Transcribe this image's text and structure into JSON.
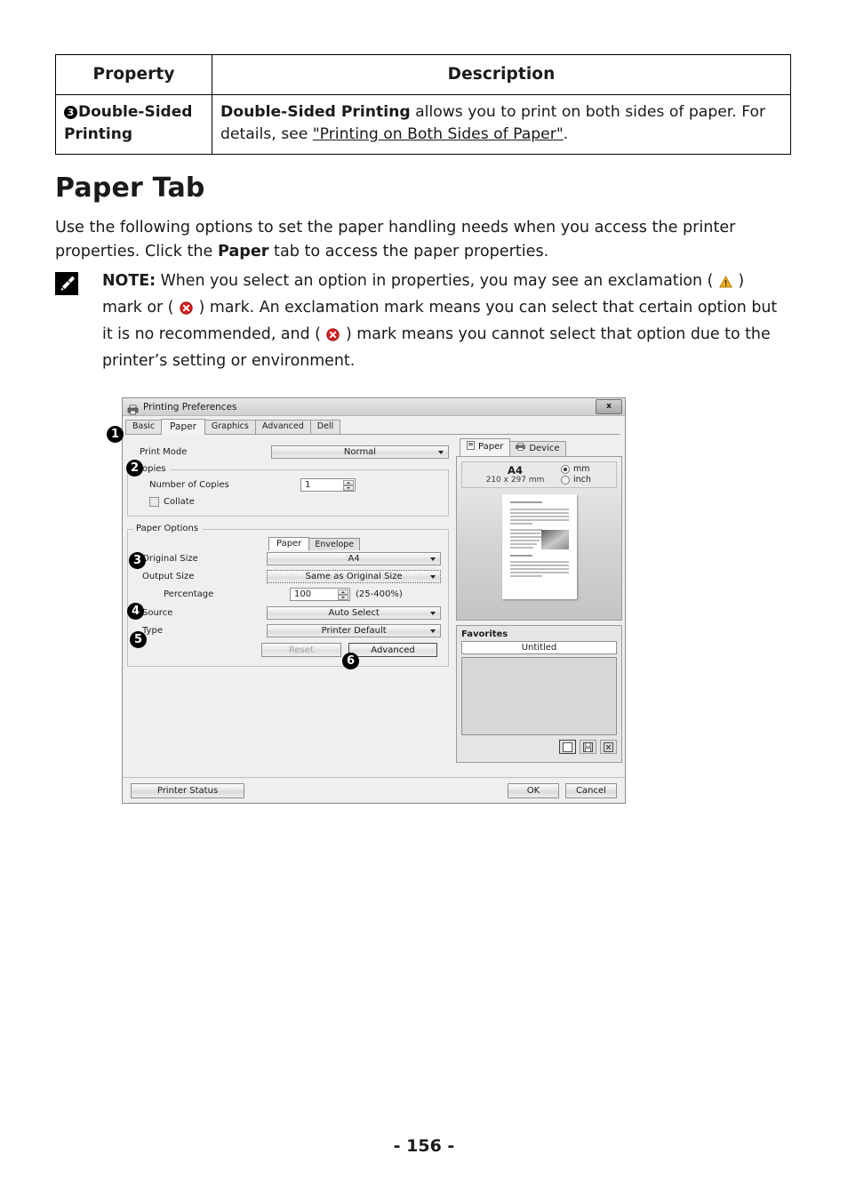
{
  "table": {
    "headers": [
      "Property",
      "Description"
    ],
    "rows": [
      {
        "badge": "3",
        "property": "Double-Sided Printing",
        "desc_bold": "Double-Sided Printing",
        "desc_rest": " allows you to print on both sides of paper. For details, see ",
        "desc_link": "\"Printing on Both Sides of Paper\"",
        "desc_end": "."
      }
    ]
  },
  "heading": "Paper Tab",
  "intro": {
    "part1": "Use the following options to set the paper handling needs when you access the printer properties. Click the ",
    "bold": "Paper",
    "part2": " tab to access the paper properties."
  },
  "note": {
    "label": "NOTE:",
    "text1": " When you select an option in properties, you may see an exclamation ( ",
    "text2": " ) mark or ( ",
    "text3": " ) mark. An exclamation mark means you can select that certain option but it is no recommended, and ( ",
    "text4": " ) mark means you cannot select that option due to the printer’s setting or environment.",
    "warn_icon": "warning-triangle-icon",
    "error_icon": "error-circle-icon",
    "note_icon": "pencil-note-icon",
    "warn_color": "#f2b01e",
    "error_color": "#d81f1f"
  },
  "dialog": {
    "title": "Printing Preferences",
    "close_label": "x",
    "tabs": [
      {
        "label": "Basic",
        "active": false
      },
      {
        "label": "Paper",
        "active": true
      },
      {
        "label": "Graphics",
        "active": false
      },
      {
        "label": "Advanced",
        "active": false
      },
      {
        "label": "Dell",
        "active": false
      }
    ],
    "print_mode": {
      "label": "Print Mode",
      "value": "Normal"
    },
    "copies": {
      "group_title": "Copies",
      "number_label": "Number of Copies",
      "number_value": "1",
      "collate_label": "Collate",
      "collate_checked": false
    },
    "paper_options": {
      "group_title": "Paper Options",
      "minitabs": [
        {
          "label": "Paper",
          "active": true
        },
        {
          "label": "Envelope",
          "active": false
        }
      ],
      "original_size": {
        "label": "Original Size",
        "value": "A4"
      },
      "output_size": {
        "label": "Output Size",
        "value": "Same as Original Size"
      },
      "percentage": {
        "label": "Percentage",
        "value": "100",
        "range": "(25-400%)"
      },
      "source": {
        "label": "Source",
        "value": "Auto Select"
      },
      "type": {
        "label": "Type",
        "value": "Printer Default"
      },
      "reset_label": "Reset",
      "advanced_label": "Advanced"
    },
    "preview": {
      "tabs": [
        {
          "label": "Paper",
          "active": true,
          "icon": "page-icon"
        },
        {
          "label": "Device",
          "active": false,
          "icon": "printer-icon"
        }
      ],
      "paper_name": "A4",
      "paper_dims": "210 x 297 mm",
      "units": [
        {
          "label": "mm",
          "selected": true
        },
        {
          "label": "inch",
          "selected": false
        }
      ]
    },
    "favorites": {
      "title": "Favorites",
      "selected": "Untitled",
      "buttons": [
        "new-favorite-icon",
        "save-favorite-icon",
        "delete-favorite-icon"
      ]
    },
    "footer": {
      "printer_status": "Printer Status",
      "ok": "OK",
      "cancel": "Cancel"
    },
    "callouts": [
      "1",
      "2",
      "3",
      "4",
      "5",
      "6"
    ]
  },
  "page_number": "- 156 -"
}
